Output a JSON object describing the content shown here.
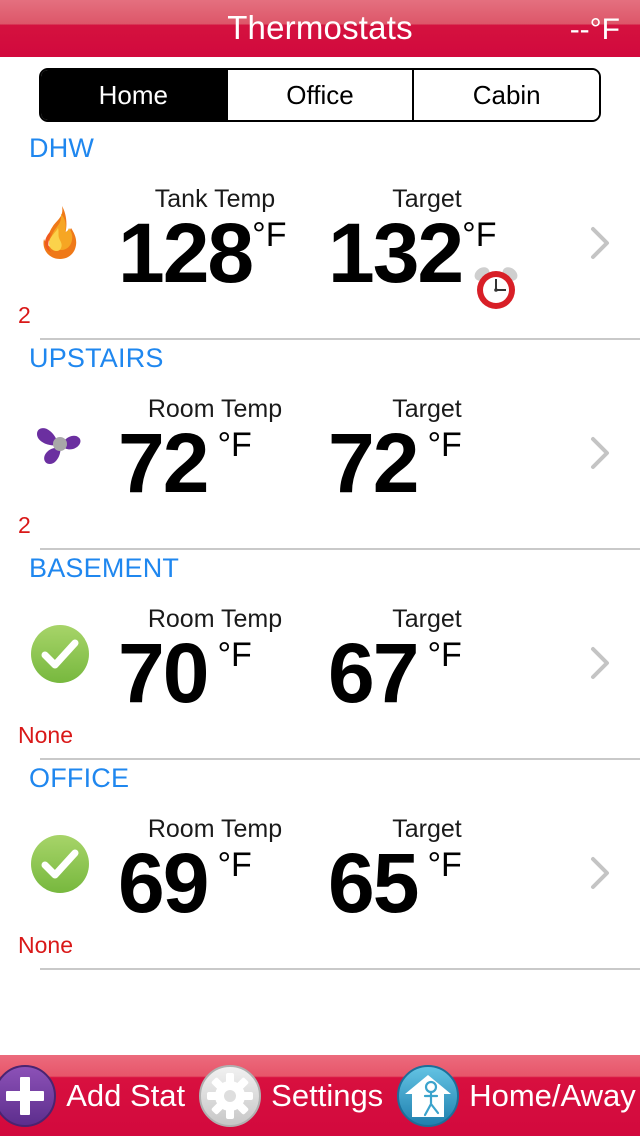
{
  "header": {
    "title": "Thermostats",
    "outside_temp": "--°F"
  },
  "location_tabs": {
    "selected": "Home",
    "items": [
      {
        "label": "Home",
        "selected": true
      },
      {
        "label": "Office",
        "selected": false
      },
      {
        "label": "Cabin",
        "selected": false
      }
    ]
  },
  "thermostats": [
    {
      "name": "DHW",
      "status_icon": "flame-icon",
      "schedule_count": "2",
      "current_label": "Tank Temp",
      "current_value": "128",
      "current_unit": "°F",
      "target_label": "Target",
      "target_value": "132",
      "target_unit": "°F",
      "has_alarm": true,
      "alarm_icon": "alarm-clock-icon",
      "disclosure": "chevron-right-icon"
    },
    {
      "name": "UPSTAIRS",
      "status_icon": "fan-icon",
      "schedule_count": "2",
      "current_label": "Room Temp",
      "current_value": "72",
      "current_unit": "°F",
      "target_label": "Target",
      "target_value": "72",
      "target_unit": "°F",
      "has_alarm": false,
      "alarm_icon": "",
      "disclosure": "chevron-right-icon"
    },
    {
      "name": "BASEMENT",
      "status_icon": "check-circle-icon",
      "schedule_count": "None",
      "current_label": "Room Temp",
      "current_value": "70",
      "current_unit": "°F",
      "target_label": "Target",
      "target_value": "67",
      "target_unit": "°F",
      "has_alarm": false,
      "alarm_icon": "",
      "disclosure": "chevron-right-icon"
    },
    {
      "name": "OFFICE",
      "status_icon": "check-circle-icon",
      "schedule_count": "None",
      "current_label": "Room Temp",
      "current_value": "69",
      "current_unit": "°F",
      "target_label": "Target",
      "target_value": "65",
      "target_unit": "°F",
      "has_alarm": false,
      "alarm_icon": "",
      "disclosure": "chevron-right-icon"
    }
  ],
  "toolbar": {
    "add_stat_label": "Add Stat",
    "add_stat_icon": "plus-circle-icon",
    "settings_label": "Settings",
    "settings_icon": "gear-icon",
    "home_away_label": "Home/Away",
    "home_away_icon": "house-person-icon"
  },
  "colors": {
    "header_red": "#d2093d",
    "header_red_light": "#e4707f",
    "section_title_blue": "#1f87ef",
    "schedule_red": "#d91818",
    "ok_green": "#8cc64f",
    "fan_purple": "#6b2fa0",
    "alarm_red": "#d81f27",
    "add_purple": "#7b3fa8",
    "home_blue": "#3aa7d4"
  }
}
